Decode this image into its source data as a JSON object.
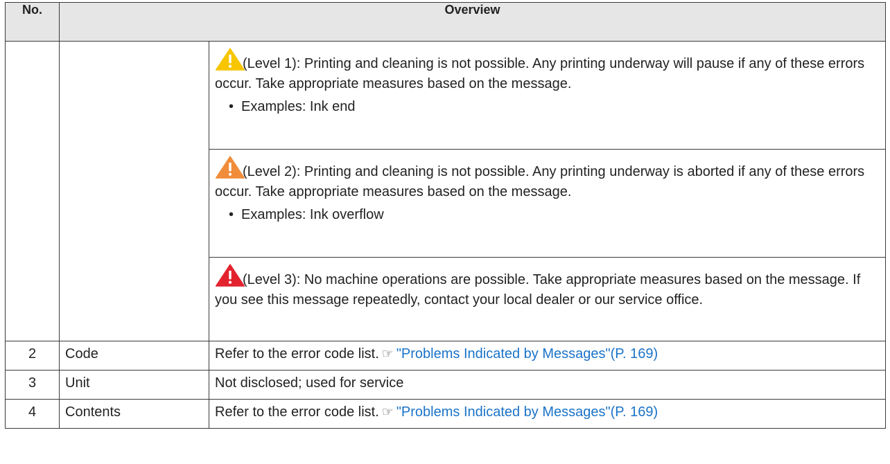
{
  "header": {
    "no": "No.",
    "overview": "Overview"
  },
  "levels": [
    {
      "icon": "warning-icon-yellow",
      "color": "#f7c600",
      "text": "(Level 1): Printing and cleaning is not possible. Any printing underway will pause if any of these errors occur. Take appropriate measures based on the message.",
      "example": "Examples: Ink end"
    },
    {
      "icon": "warning-icon-orange",
      "color": "#f08c3a",
      "text": "(Level 2): Printing and cleaning is not possible. Any printing underway is aborted if any of these errors occur. Take appropriate measures based on the message.",
      "example": "Examples: Ink overflow"
    },
    {
      "icon": "warning-icon-red",
      "color": "#e2232e",
      "text": "(Level 3): No machine operations are possible. Take appropriate measures based on the message. If you see this message repeatedly, contact your local dealer or our service office."
    }
  ],
  "bullet": "•",
  "reference_icon": "pointing-hand-icon",
  "rows": [
    {
      "no": "2",
      "item": "Code",
      "text": "Refer to the error code list.",
      "link": "\"Problems Indicated by Messages\"(P. 169)"
    },
    {
      "no": "3",
      "item": "Unit",
      "text": "Not disclosed; used for service"
    },
    {
      "no": "4",
      "item": "Contents",
      "text": "Refer to the error code list.",
      "link": "\"Problems Indicated by Messages\"(P. 169)"
    }
  ],
  "colors": {
    "header_bg": "#e6e6e6",
    "link": "#1a73c8",
    "border": "#3a3a3a"
  }
}
